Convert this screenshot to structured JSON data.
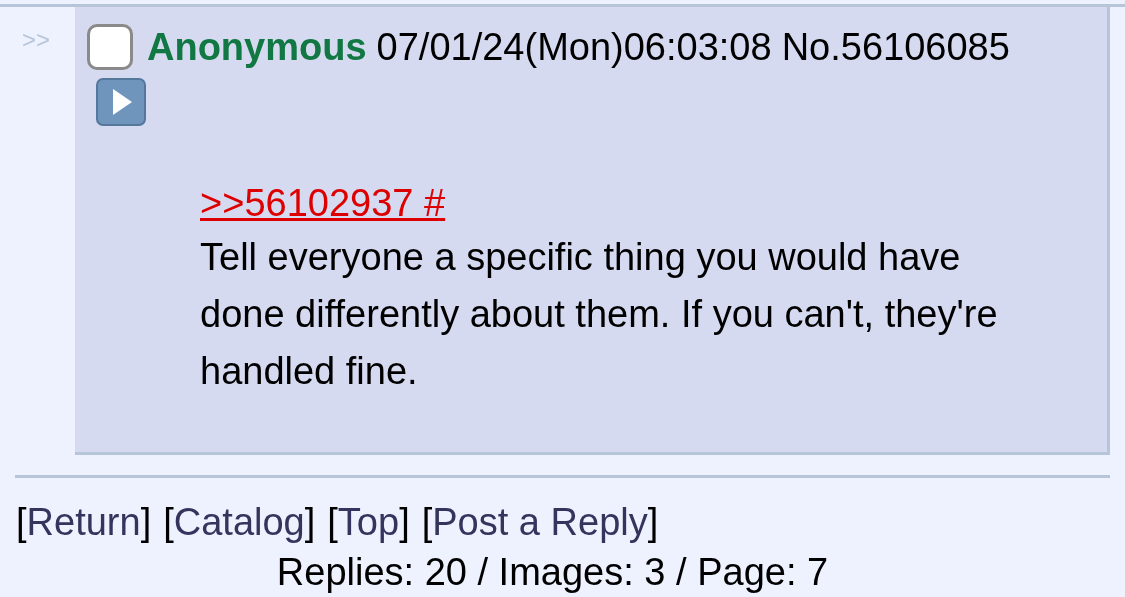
{
  "post": {
    "side_arrows": ">>",
    "checked": false,
    "name": "Anonymous",
    "datetime": "07/01/24(Mon)06:03:08",
    "number": "No.56106085",
    "quote": ">>56102937 #",
    "message": "Tell everyone a specific thing you would have done differently about them. If you can't, they're handled fine."
  },
  "nav_links": [
    {
      "open": "[",
      "label": "Return",
      "close": "]"
    },
    {
      "open": "[",
      "label": "Catalog",
      "close": "]"
    },
    {
      "open": "[",
      "label": "Top",
      "close": "]"
    },
    {
      "open": "[",
      "label": "Post a Reply",
      "close": "]"
    }
  ],
  "stats": "Replies: 20 / Images: 3 / Page: 7"
}
